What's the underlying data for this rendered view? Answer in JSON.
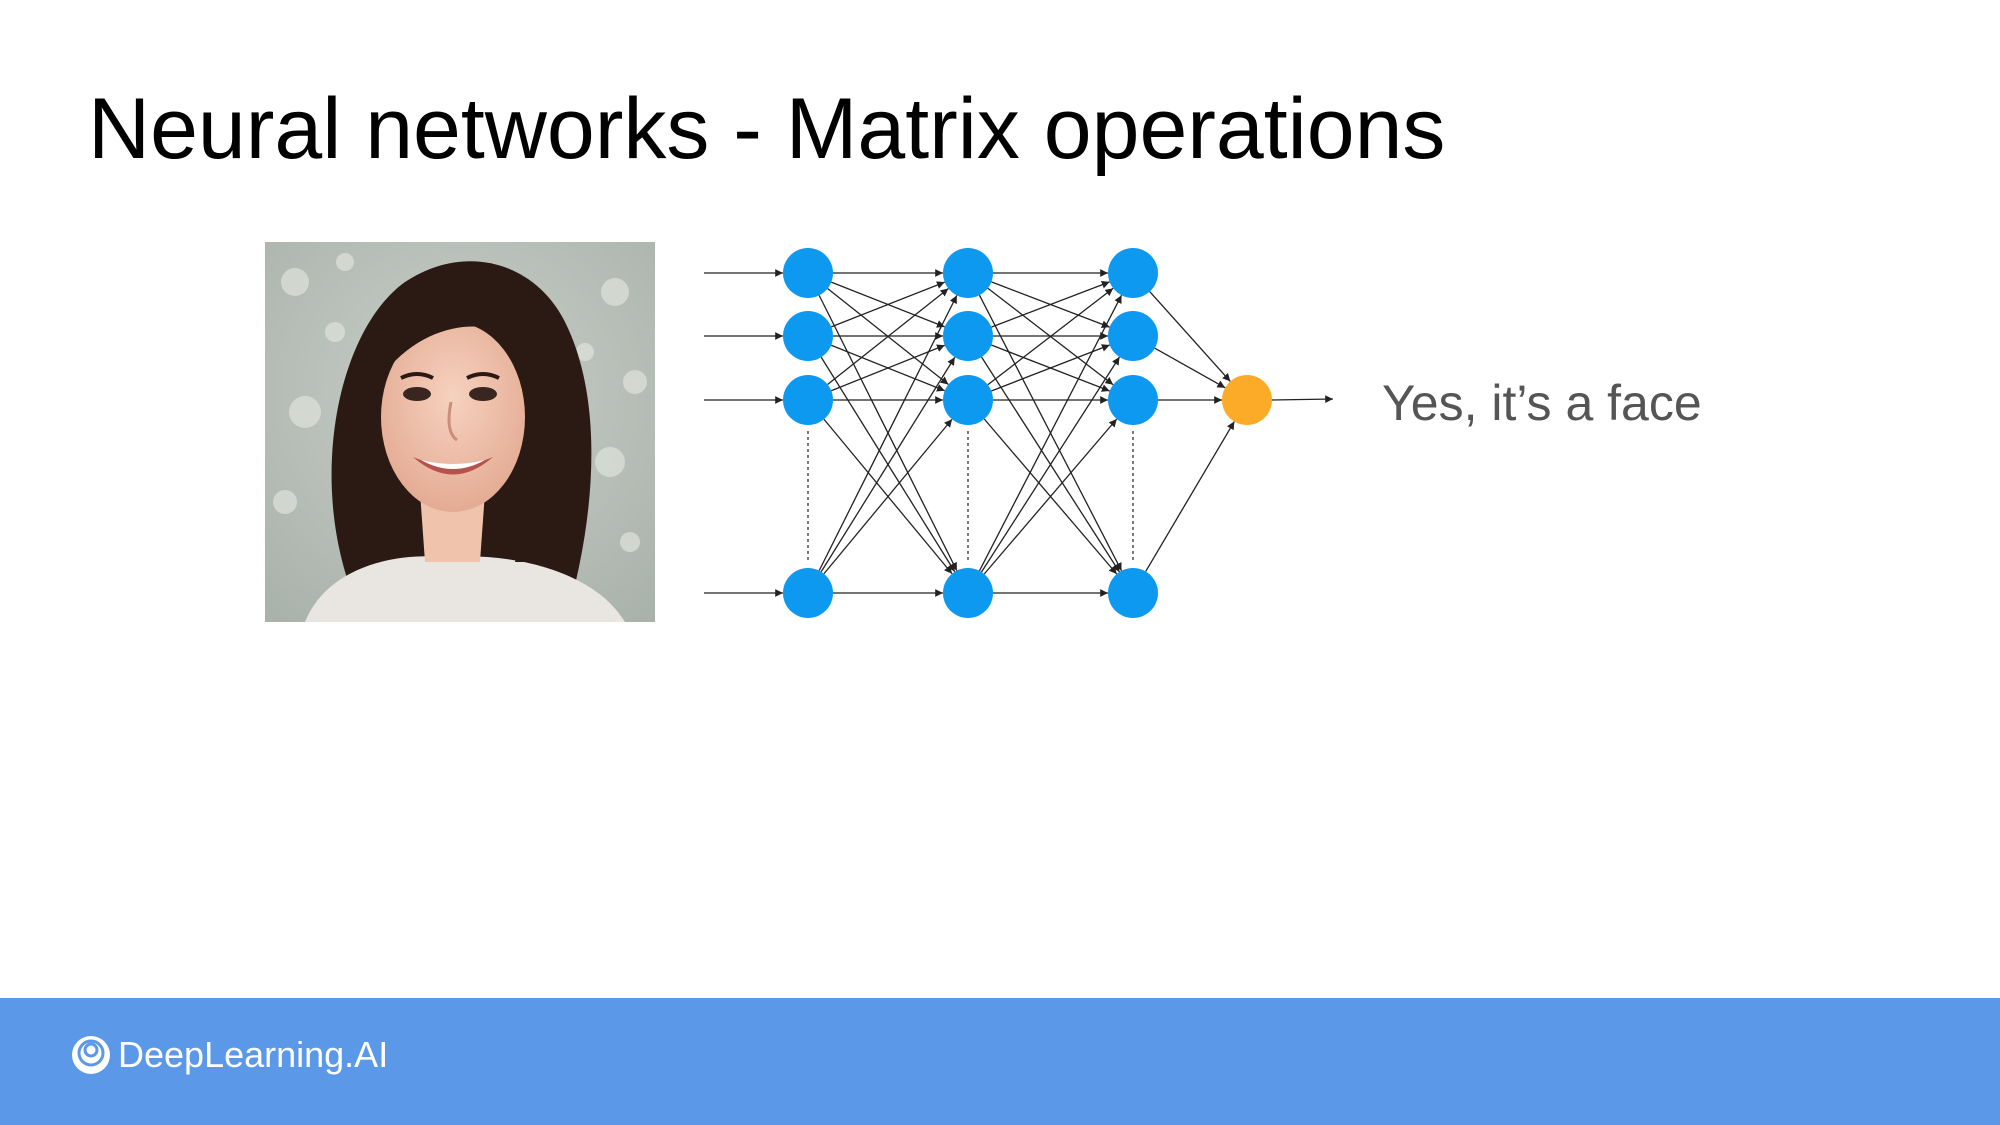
{
  "slide": {
    "title": "Neural networks - Matrix operations",
    "output_text": "Yes, it’s a face"
  },
  "footer": {
    "brand": "DeepLearning.AI",
    "background": "#5b98e8"
  },
  "colors": {
    "node": "#0d99f0",
    "output_node": "#fbab27",
    "edge": "#222222"
  },
  "icons": {
    "brand": "deeplearning-ai-logo-icon",
    "photo": "face-photo"
  }
}
